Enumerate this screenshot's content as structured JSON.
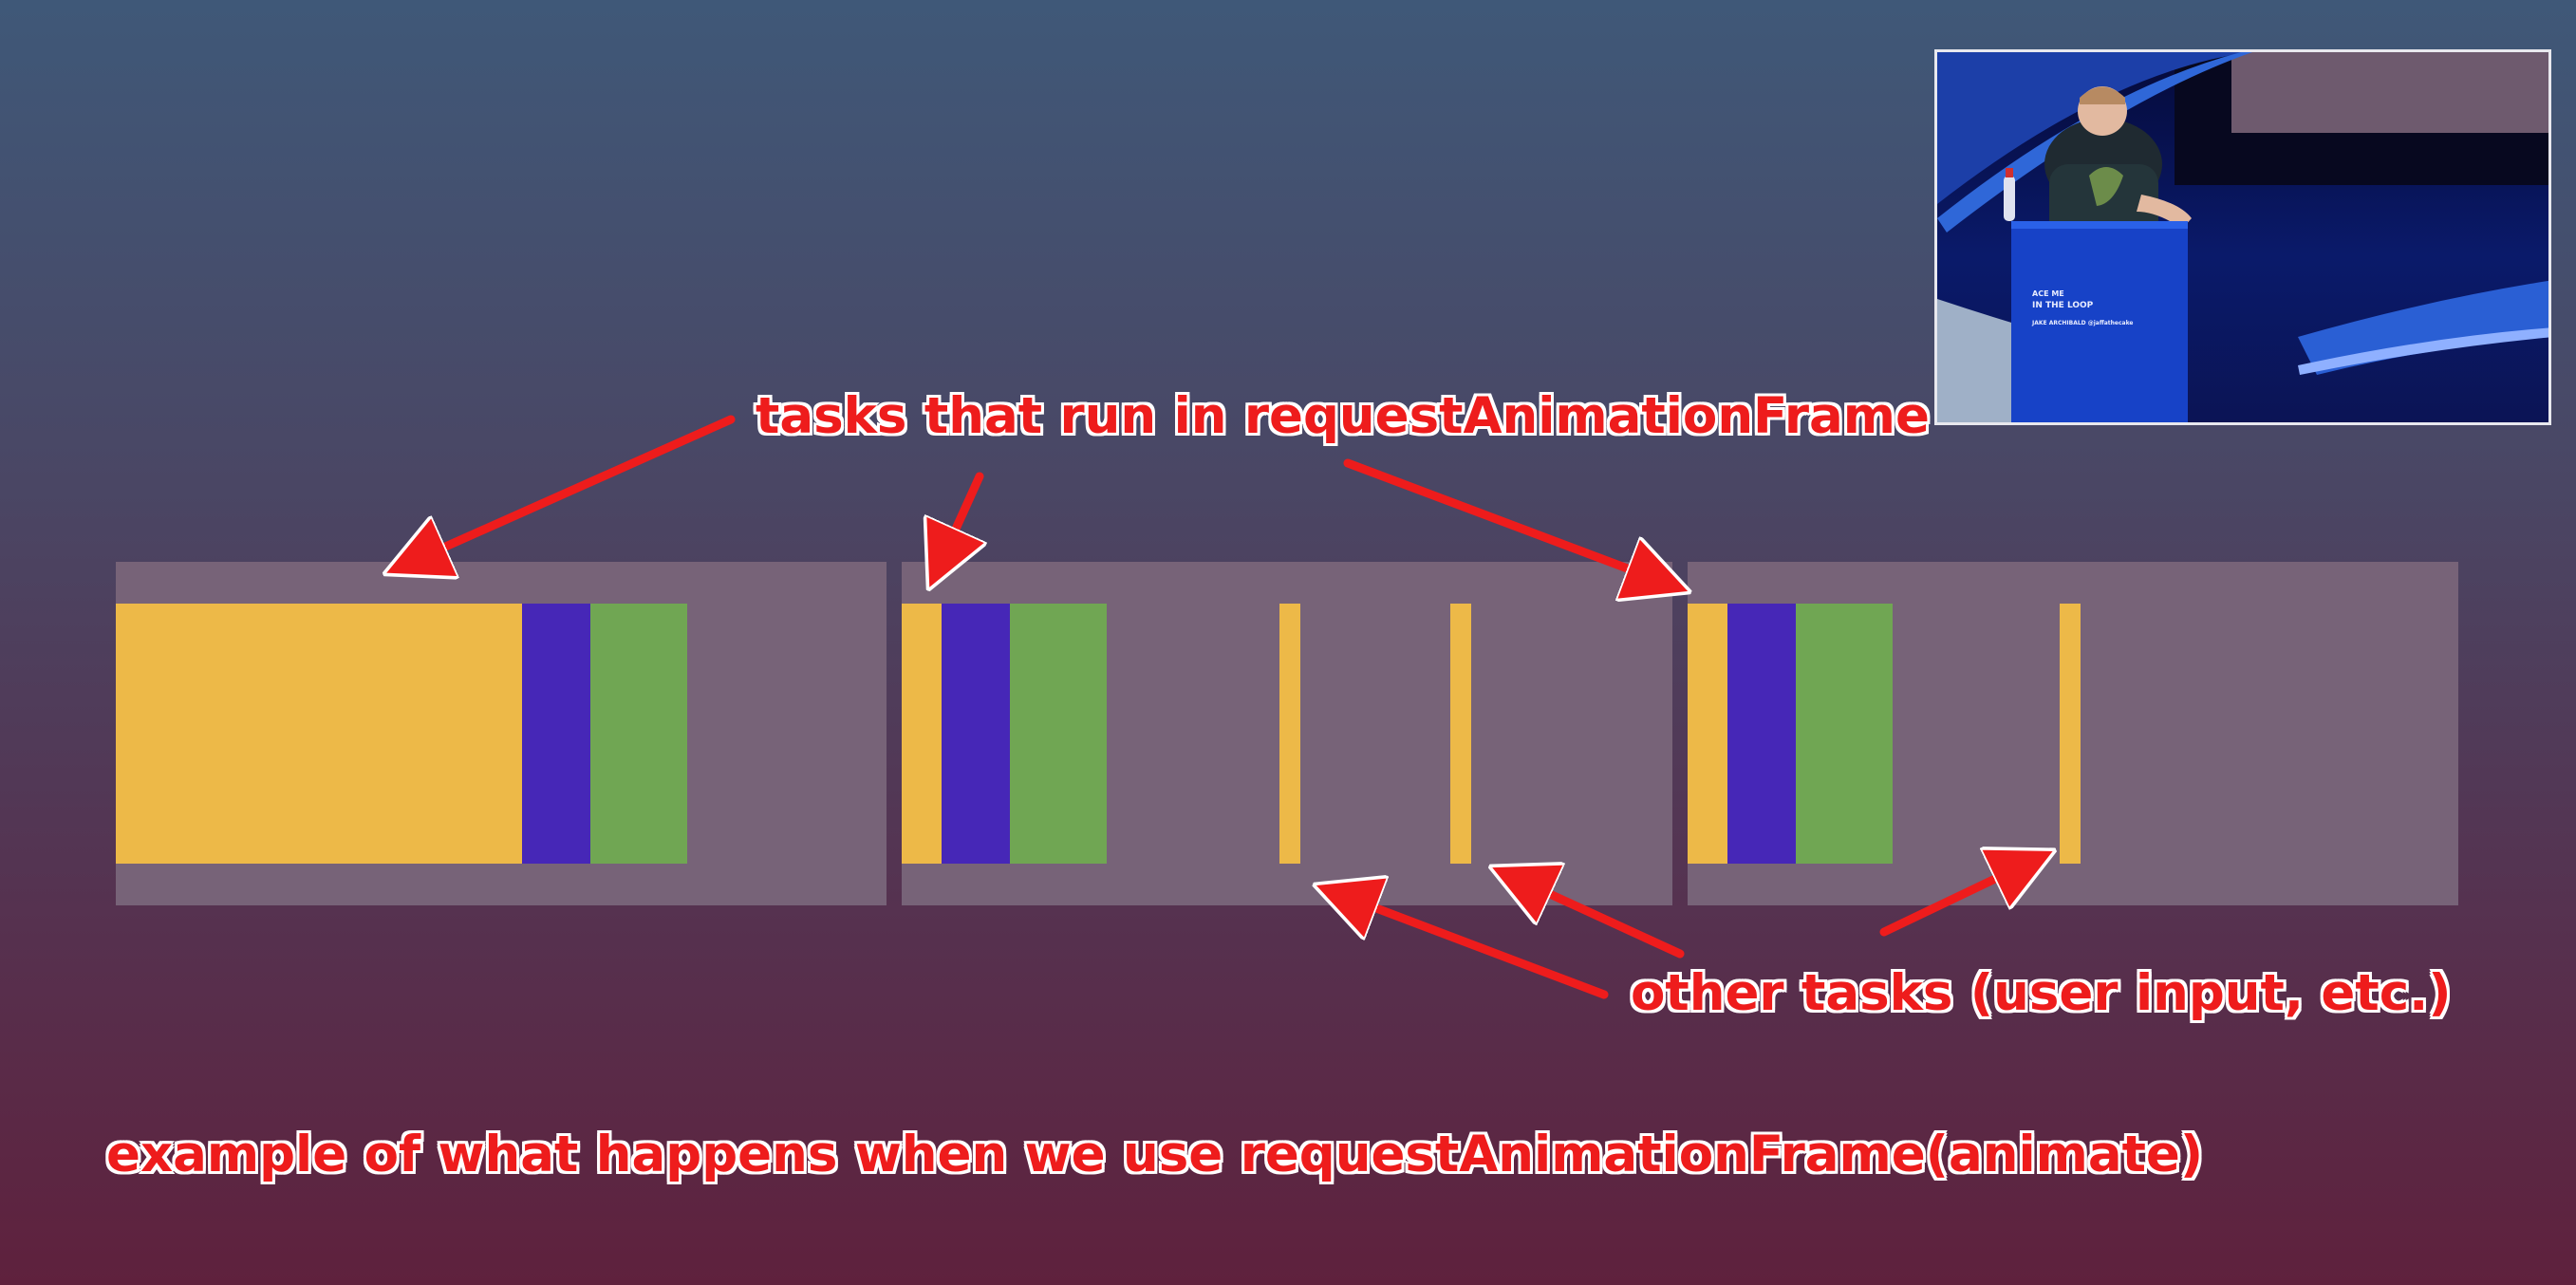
{
  "annotations": {
    "top_label": "tasks that run in requestAnimationFrame",
    "bottom_label": "other tasks (user input, etc.)",
    "caption": "example of what happens when we use requestAnimationFrame(animate)"
  },
  "colors": {
    "frame": "#776378",
    "yellow": "#edb948",
    "purple": "#4627b7",
    "green": "#70a653",
    "annotation_red": "#ee1c1c"
  },
  "video": {
    "podium_line1": "ACE ME",
    "podium_line2": "IN THE LOOP",
    "podium_line3": "JAKE ARCHIBALD  @jaffathecake"
  }
}
